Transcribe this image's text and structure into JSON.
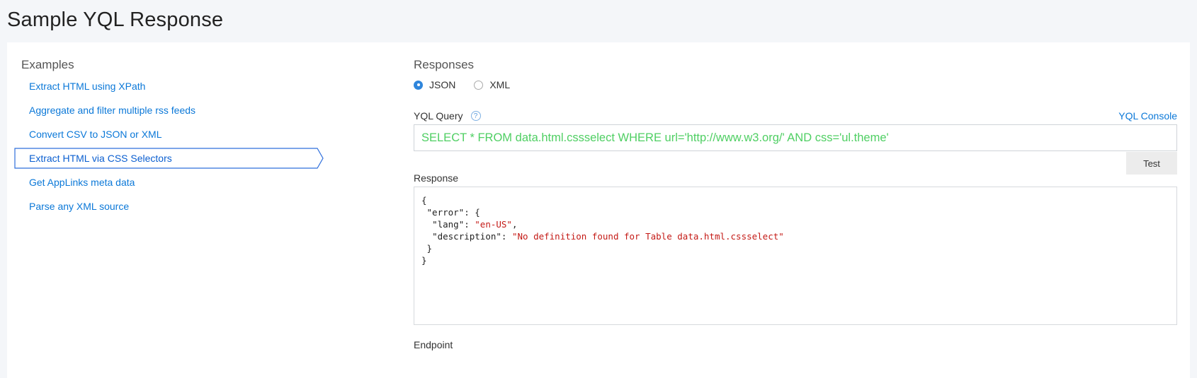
{
  "page": {
    "title": "Sample YQL Response"
  },
  "examples": {
    "heading": "Examples",
    "items": [
      {
        "label": "Extract HTML using XPath"
      },
      {
        "label": "Aggregate and filter multiple rss feeds"
      },
      {
        "label": "Convert CSV to JSON or XML"
      },
      {
        "label": "Extract HTML via CSS Selectors"
      },
      {
        "label": "Get AppLinks meta data"
      },
      {
        "label": "Parse any XML source"
      }
    ],
    "selected_index": 3
  },
  "responses": {
    "heading": "Responses",
    "formats": [
      {
        "label": "JSON",
        "checked": true
      },
      {
        "label": "XML",
        "checked": false
      }
    ]
  },
  "query": {
    "label": "YQL Query",
    "help_icon": "question-circle-icon",
    "console_link": "YQL Console",
    "value": "SELECT * FROM data.html.cssselect WHERE url='http://www.w3.org/' AND css='ul.theme'",
    "test_label": "Test"
  },
  "response": {
    "label": "Response",
    "lines": {
      "open": "{",
      "error_key": "\"error\"",
      "error_open": ": {",
      "lang_key": "\"lang\"",
      "lang_val": "\"en-US\"",
      "desc_key": "\"description\"",
      "desc_val": "\"No definition found for Table data.html.cssselect\"",
      "inner_close": "}",
      "close": "}"
    }
  },
  "endpoint": {
    "label": "Endpoint"
  },
  "colors": {
    "link": "#0b78d8",
    "query_text": "#4fcf63",
    "json_string": "#c41a16",
    "radio_checked": "#2f86dc"
  }
}
